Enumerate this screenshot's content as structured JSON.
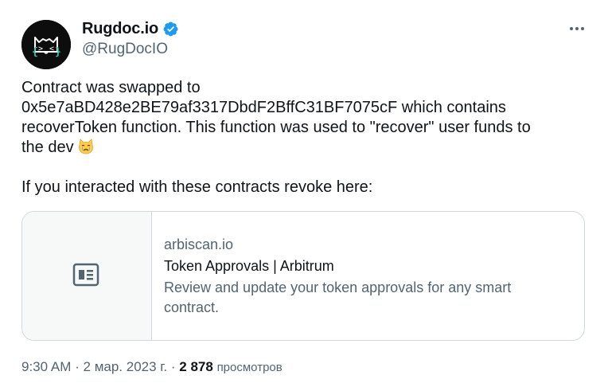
{
  "author": {
    "display_name": "Rugdoc.io",
    "handle": "@RugDocIO",
    "verified": true,
    "avatar_icon": "cat-face-logo-icon"
  },
  "more_icon": "more-horizontal-icon",
  "tweet": {
    "line1": "Contract was swapped to",
    "line2": "0x5e7aBD428e2BE79af3317DbdF2BffC31BF7075cF which contains",
    "line3": "recoverToken function. This function was used to \"recover\" user funds to",
    "line4": "the dev",
    "emoji": "crying-cat-face-icon",
    "line5": "If you interacted with these contracts revoke here:"
  },
  "card": {
    "icon": "article-icon",
    "domain": "arbiscan.io",
    "title": "Token Approvals | Arbitrum",
    "description_line1": "Review and update your token approvals for any smart",
    "description_line2": "contract."
  },
  "meta": {
    "time": "9:30 AM",
    "separator": "·",
    "date": "2 мар. 2023 г.",
    "views_count": "2 878",
    "views_label": "просмотров"
  },
  "colors": {
    "text": "#0f1419",
    "secondary": "#536471",
    "verified_badge": "#1d9bf0",
    "border": "#cfd9de"
  }
}
